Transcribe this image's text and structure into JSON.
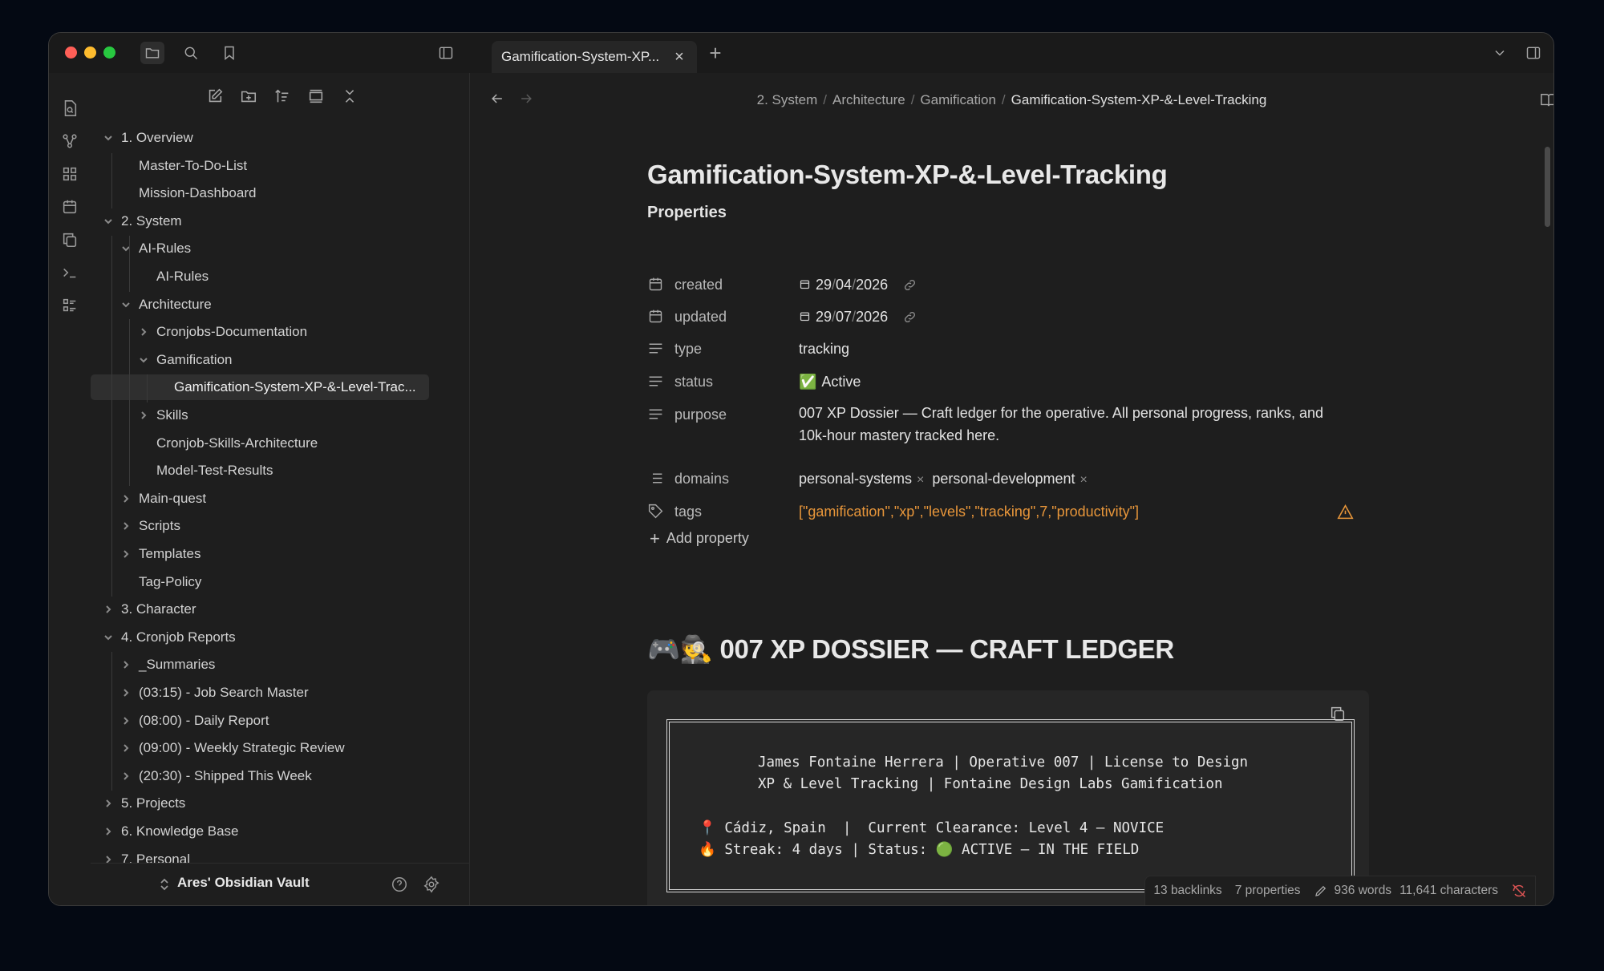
{
  "tab": {
    "title": "Gamification-System-XP...",
    "close": "×",
    "new": "+"
  },
  "breadcrumb": [
    "2. System",
    "Architecture",
    "Gamification",
    "Gamification-System-XP-&-Level-Tracking"
  ],
  "breadcrumb_sep": "/",
  "tree": [
    {
      "label": "1. Overview",
      "depth": 0,
      "chev": "down"
    },
    {
      "label": "Master-To-Do-List",
      "depth": 1,
      "chev": "none"
    },
    {
      "label": "Mission-Dashboard",
      "depth": 1,
      "chev": "none"
    },
    {
      "label": "2. System",
      "depth": 0,
      "chev": "down"
    },
    {
      "label": "AI-Rules",
      "depth": 1,
      "chev": "down"
    },
    {
      "label": "AI-Rules",
      "depth": 2,
      "chev": "none"
    },
    {
      "label": "Architecture",
      "depth": 1,
      "chev": "down"
    },
    {
      "label": "Cronjobs-Documentation",
      "depth": 2,
      "chev": "right"
    },
    {
      "label": "Gamification",
      "depth": 2,
      "chev": "down"
    },
    {
      "label": "Gamification-System-XP-&-Level-Trac...",
      "depth": 3,
      "chev": "none",
      "active": true
    },
    {
      "label": "Skills",
      "depth": 2,
      "chev": "right"
    },
    {
      "label": "Cronjob-Skills-Architecture",
      "depth": 2,
      "chev": "none"
    },
    {
      "label": "Model-Test-Results",
      "depth": 2,
      "chev": "none"
    },
    {
      "label": "Main-quest",
      "depth": 1,
      "chev": "right"
    },
    {
      "label": "Scripts",
      "depth": 1,
      "chev": "right"
    },
    {
      "label": "Templates",
      "depth": 1,
      "chev": "right"
    },
    {
      "label": "Tag-Policy",
      "depth": 1,
      "chev": "none"
    },
    {
      "label": "3. Character",
      "depth": 0,
      "chev": "right"
    },
    {
      "label": "4. Cronjob Reports",
      "depth": 0,
      "chev": "down"
    },
    {
      "label": "_Summaries",
      "depth": 1,
      "chev": "right"
    },
    {
      "label": "(03:15) - Job Search Master",
      "depth": 1,
      "chev": "right"
    },
    {
      "label": "(08:00) - Daily Report",
      "depth": 1,
      "chev": "right"
    },
    {
      "label": "(09:00) - Weekly Strategic Review",
      "depth": 1,
      "chev": "right"
    },
    {
      "label": "(20:30) - Shipped This Week",
      "depth": 1,
      "chev": "right"
    },
    {
      "label": "5. Projects",
      "depth": 0,
      "chev": "right"
    },
    {
      "label": "6. Knowledge Base",
      "depth": 0,
      "chev": "right"
    },
    {
      "label": "7. Personal",
      "depth": 0,
      "chev": "right"
    }
  ],
  "vault": {
    "name": "Ares' Obsidian Vault"
  },
  "doc": {
    "title": "Gamification-System-XP-&-Level-Tracking",
    "properties_heading": "Properties",
    "properties": {
      "created": {
        "key": "created",
        "date": [
          "29",
          "04",
          "2026"
        ]
      },
      "updated": {
        "key": "updated",
        "date": [
          "29",
          "07",
          "2026"
        ]
      },
      "type": {
        "key": "type",
        "value": "tracking"
      },
      "status": {
        "key": "status",
        "value": "Active",
        "emoji": "✅"
      },
      "purpose": {
        "key": "purpose",
        "line1": "007 XP Dossier — Craft ledger for the operative. All personal progress, ranks, and",
        "line2": "10k-hour mastery tracked here."
      },
      "domains": {
        "key": "domains",
        "values": [
          "personal-systems",
          "personal-development"
        ]
      },
      "tags": {
        "key": "tags",
        "value": "[\"gamification\",\"xp\",\"levels\",\"tracking\",7,\"productivity\"]"
      }
    },
    "add_property": "Add property",
    "heading": "🎮🕵️ 007 XP DOSSIER — CRAFT LEDGER",
    "code_lines": [
      "James Fontaine Herrera | Operative 007 | License to Design",
      "XP & Level Tracking | Fontaine Design Labs Gamification",
      "📍 Cádiz, Spain  |  Current Clearance: Level 4 — NOVICE",
      "🔥 Streak: 4 days | Status: 🟢 ACTIVE — IN THE FIELD"
    ]
  },
  "statusbar": {
    "backlinks": "13 backlinks",
    "properties": "7 properties",
    "words": "936 words",
    "characters": "11,641 characters"
  },
  "colors": {
    "accent_tag": "#e8963a",
    "warning": "#e8963a",
    "traffic_red": "#ff5f57",
    "traffic_yellow": "#febc2e",
    "traffic_green": "#28c840"
  }
}
